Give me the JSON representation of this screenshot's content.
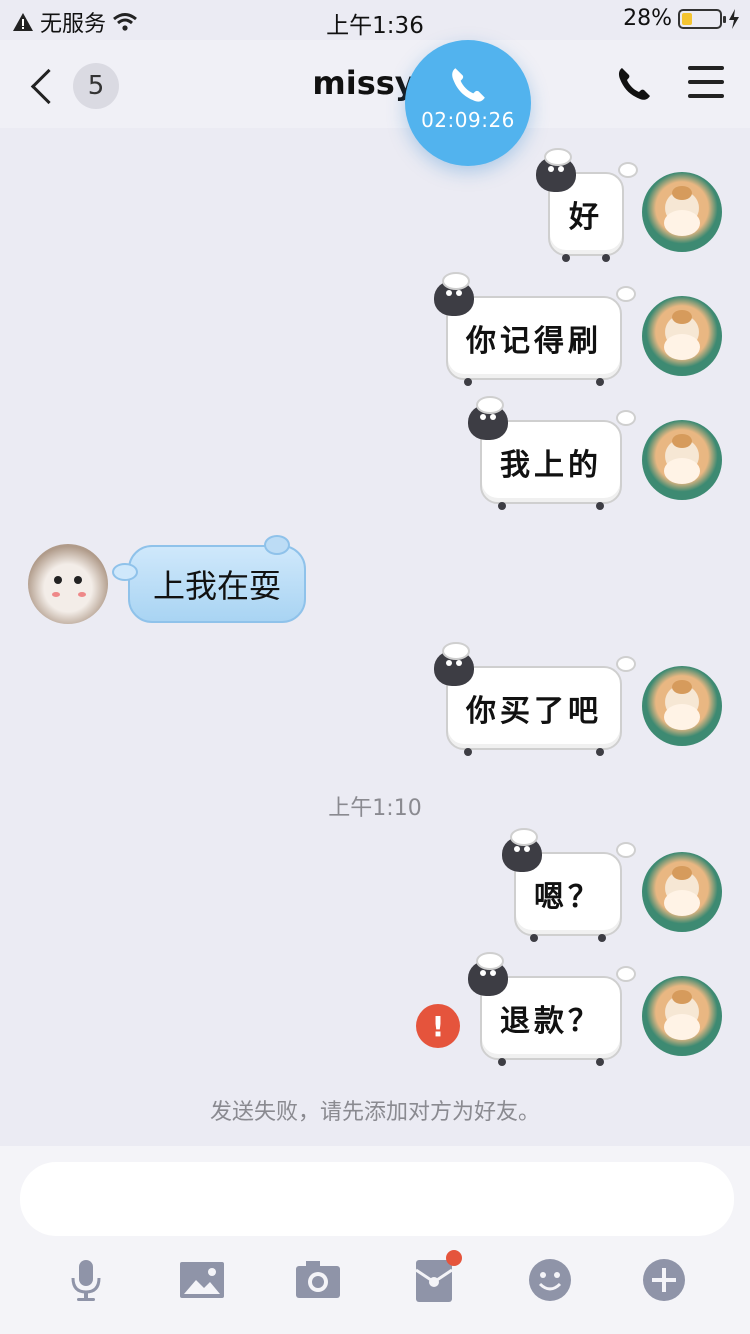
{
  "status_bar": {
    "carrier": "无服务",
    "time": "上午1:36",
    "battery": "28%",
    "battery_level": 0.28
  },
  "header": {
    "back_count": "5",
    "title": "missyo",
    "call_timer": "02:09:26"
  },
  "messages": [
    {
      "side": "right",
      "text": "好"
    },
    {
      "side": "right",
      "text": "你记得刷"
    },
    {
      "side": "right",
      "text": "我上的"
    },
    {
      "side": "left",
      "text": "上我在耍"
    },
    {
      "side": "right",
      "text": "你买了吧"
    },
    {
      "side": "right",
      "text": "嗯？"
    },
    {
      "side": "right",
      "text": "退款？",
      "failed": true
    }
  ],
  "timestamp": "上午1:10",
  "fail_notice": "发送失败，请先添加对方为好友。",
  "input": {
    "value": "",
    "placeholder": ""
  },
  "toolbar": [
    "microphone-icon",
    "image-icon",
    "camera-icon",
    "red-packet-icon",
    "emoji-icon",
    "plus-icon"
  ],
  "colors": {
    "accent": "#52b3ee",
    "error": "#e5543c",
    "background": "#ebebf3"
  }
}
